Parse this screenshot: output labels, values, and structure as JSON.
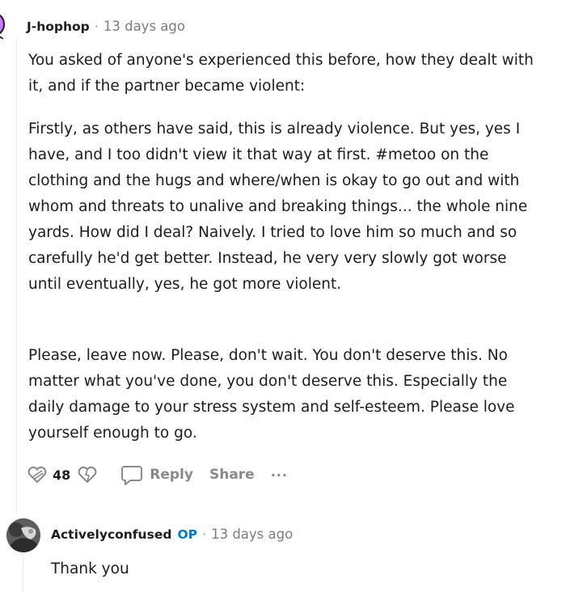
{
  "comment": {
    "author": "J-hophop",
    "separator": "·",
    "time": "13 days ago",
    "paragraphs": [
      "You asked of anyone's experienced this before, how they dealt with it, and if the partner became violent:",
      "Firstly, as others have said, this is already violence. But yes, yes I have, and I too didn't view it that way at first. #metoo on the clothing and the hugs and where/when is okay to go out and with whom and threats to unalive and breaking things... the whole nine yards. How did I deal? Naively. I tried to love him so much and so carefully he'd get better. Instead, he very very slowly got worse until eventually, yes, he got more violent.",
      "Please, leave now. Please, don't wait. You don't deserve this. No matter what you've done, you don't deserve this. Especially the daily damage to your stress system and self-esteem. Please love yourself enough to go."
    ],
    "vote_count": "48",
    "reply_label": "Reply",
    "share_label": "Share",
    "more_label": "···"
  },
  "reply": {
    "author": "Activelyconfused",
    "op_badge": "OP",
    "separator": "·",
    "time": "13 days ago",
    "text": "Thank you"
  }
}
